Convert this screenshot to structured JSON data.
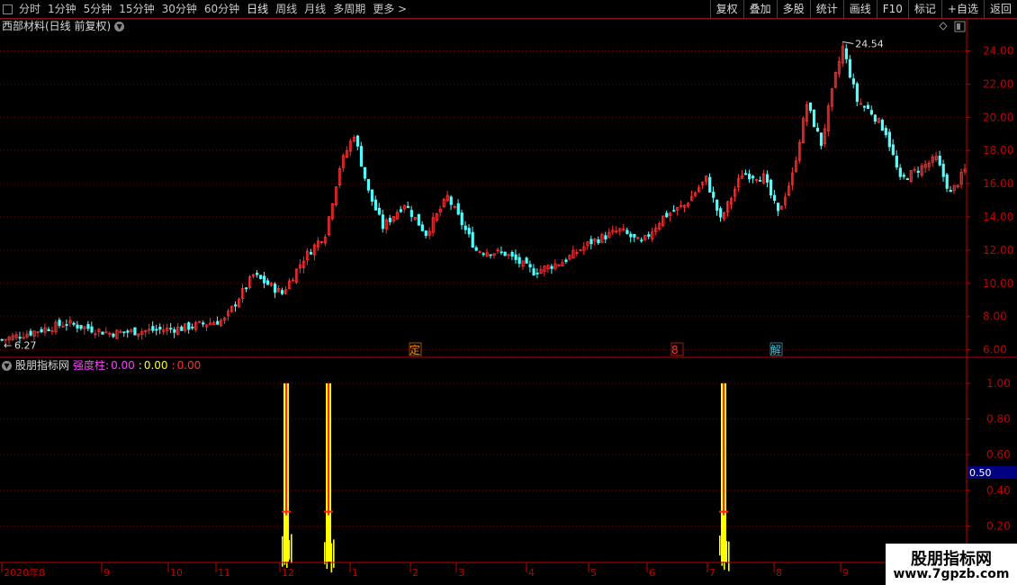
{
  "toolbar": {
    "periods": [
      "分时",
      "1分钟",
      "5分钟",
      "15分钟",
      "30分钟",
      "60分钟",
      "日线",
      "周线",
      "月线",
      "多周期",
      "更多"
    ],
    "active_period": "日线",
    "actions": [
      "复权",
      "叠加",
      "多股",
      "统计",
      "画线",
      "F10",
      "标记",
      "+自选",
      "返回"
    ]
  },
  "main_chart": {
    "title": "西部材料(日线 前复权)",
    "high_label": "24.54",
    "low_label": "6.27",
    "y_ticks": [
      "24.00",
      "22.00",
      "20.00",
      "18.00",
      "16.00",
      "14.00",
      "12.00",
      "10.00",
      "8.00",
      "6.00"
    ],
    "markers": [
      {
        "text": "定",
        "color": "#ff8c00"
      },
      {
        "text": "8",
        "color": "#ff3030"
      },
      {
        "text": "解",
        "color": "#40c8e0"
      }
    ]
  },
  "indicator": {
    "name": "股朋指标网",
    "label": "强度柱:",
    "value1": "0.00",
    "sep1": ":",
    "value2": "0.00",
    "sep2": ":",
    "value3": "0.00",
    "y_ticks": [
      "1.00",
      "0.80",
      "0.60",
      "0.40",
      "0.20"
    ],
    "current_value": "0.50"
  },
  "x_axis": {
    "labels": [
      "2020年8",
      "9",
      "10",
      "11",
      "12",
      "1",
      "2",
      "3",
      "4",
      "5",
      "6",
      "7",
      "8",
      "9"
    ]
  },
  "watermark": {
    "title": "股朋指标网",
    "url": "www.7gpzb.com"
  },
  "colors": {
    "up": "#ff3030",
    "down": "#54ffff",
    "axis": "#c00000",
    "grid": "#6a0000",
    "bar_yellow": "#ffff00",
    "bar_red": "#ff2020",
    "value_box": "#000080"
  },
  "chart_data": {
    "type": "candlestick",
    "price_range": [
      5.6,
      25.0
    ],
    "key_points": [
      {
        "label": "low",
        "value": 6.27
      },
      {
        "label": "high",
        "value": 24.54
      }
    ],
    "indicator_range": [
      0,
      1.05
    ],
    "indicator_spikes": [
      {
        "value": 1.0
      },
      {
        "value": 1.0
      },
      {
        "value": 1.0
      }
    ]
  }
}
